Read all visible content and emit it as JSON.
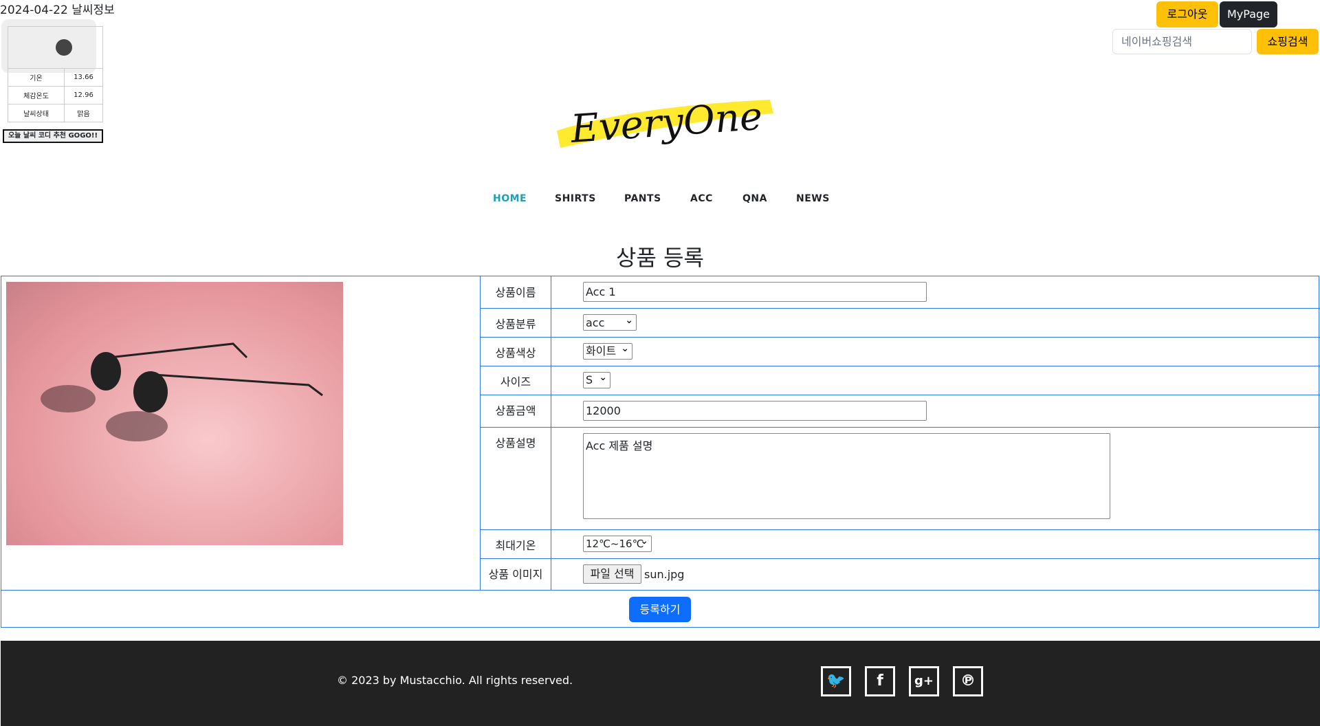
{
  "weather": {
    "title": "2024-04-22 날씨정보",
    "rows": [
      {
        "label": "기온",
        "value": "13.66"
      },
      {
        "label": "체감온도",
        "value": "12.96"
      },
      {
        "label": "날씨상태",
        "value": "맑음"
      }
    ],
    "button": "오늘 날씨 코디 추천 GOGO!!"
  },
  "header": {
    "logout": "로그아웃",
    "mypage": "MyPage",
    "search_placeholder": "네이버쇼핑검색",
    "search_button": "쇼핑검색",
    "logo": "EveryOne"
  },
  "nav": [
    "HOME",
    "SHIRTS",
    "PANTS",
    "ACC",
    "QNA",
    "NEWS"
  ],
  "form": {
    "title": "상품 등록",
    "labels": {
      "name": "상품이름",
      "category": "상품분류",
      "color": "상품색상",
      "size": "사이즈",
      "price": "상품금액",
      "desc": "상품설명",
      "temp": "최대기온",
      "image": "상품 이미지"
    },
    "values": {
      "name": "Acc 1",
      "category": "acc",
      "color": "화이트",
      "size": "S",
      "price": "12000",
      "desc": "Acc 제품 설명",
      "temp": "12℃~16℃",
      "file_button": "파일 선택",
      "file_name": "sun.jpg"
    },
    "submit": "등록하기"
  },
  "footer": {
    "copyright": "© 2023 by Mustacchio. All rights reserved.",
    "social": [
      "twitter",
      "facebook",
      "google-plus",
      "pinterest"
    ]
  }
}
